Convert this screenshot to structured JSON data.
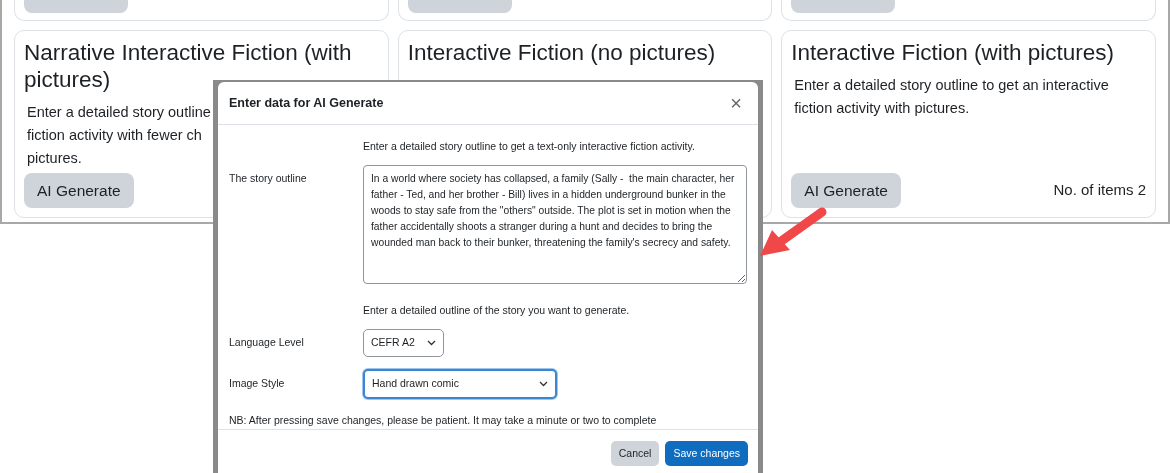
{
  "top_row_cards": [
    {
      "kind": "button-stub"
    },
    {
      "kind": "button-stub"
    },
    {
      "kind": "button-stub"
    }
  ],
  "cards": [
    {
      "title": "Narrative Interactive Fiction (with pictures)",
      "description_lines": [
        "Enter a detailed story outline",
        "fiction activity with fewer ch",
        "pictures."
      ],
      "button": "AI Generate"
    },
    {
      "title": "Interactive Fiction (no pictures)"
    },
    {
      "title": "Interactive Fiction (with pictures)",
      "description_lines": [
        "Enter a detailed story outline to get an interactive",
        "fiction activity with pictures."
      ],
      "button": "AI Generate",
      "count": "No. of items 2"
    }
  ],
  "modal": {
    "title": "Enter data for AI Generate",
    "close": "×",
    "intro": "Enter a detailed story outline to get a text-only interactive fiction activity.",
    "fields": [
      {
        "kind": "textarea",
        "label": "The story outline",
        "value": "In a world where society has collapsed, a family (Sally -  the main character, her father - Ted, and her brother - Bill) lives in a hidden underground bunker in the woods to stay safe from the \"others\" outside. The plot is set in motion when the father accidentally shoots a stranger during a hunt and decides to bring the wounded man back to their bunker, threatening the family's secrecy and safety.",
        "help": "Enter a detailed outline of the story you want to generate."
      },
      {
        "kind": "select",
        "label": "Language Level",
        "value": "CEFR A2",
        "focused": false
      },
      {
        "kind": "select",
        "label": "Image Style",
        "value": "Hand drawn comic",
        "focused": true
      }
    ],
    "note": "NB: After pressing save changes, please be patient. It may take a minute or two to complete",
    "buttons": [
      {
        "label": "Cancel",
        "kind": "secondary"
      },
      {
        "label": "Save changes",
        "kind": "primary"
      }
    ]
  }
}
